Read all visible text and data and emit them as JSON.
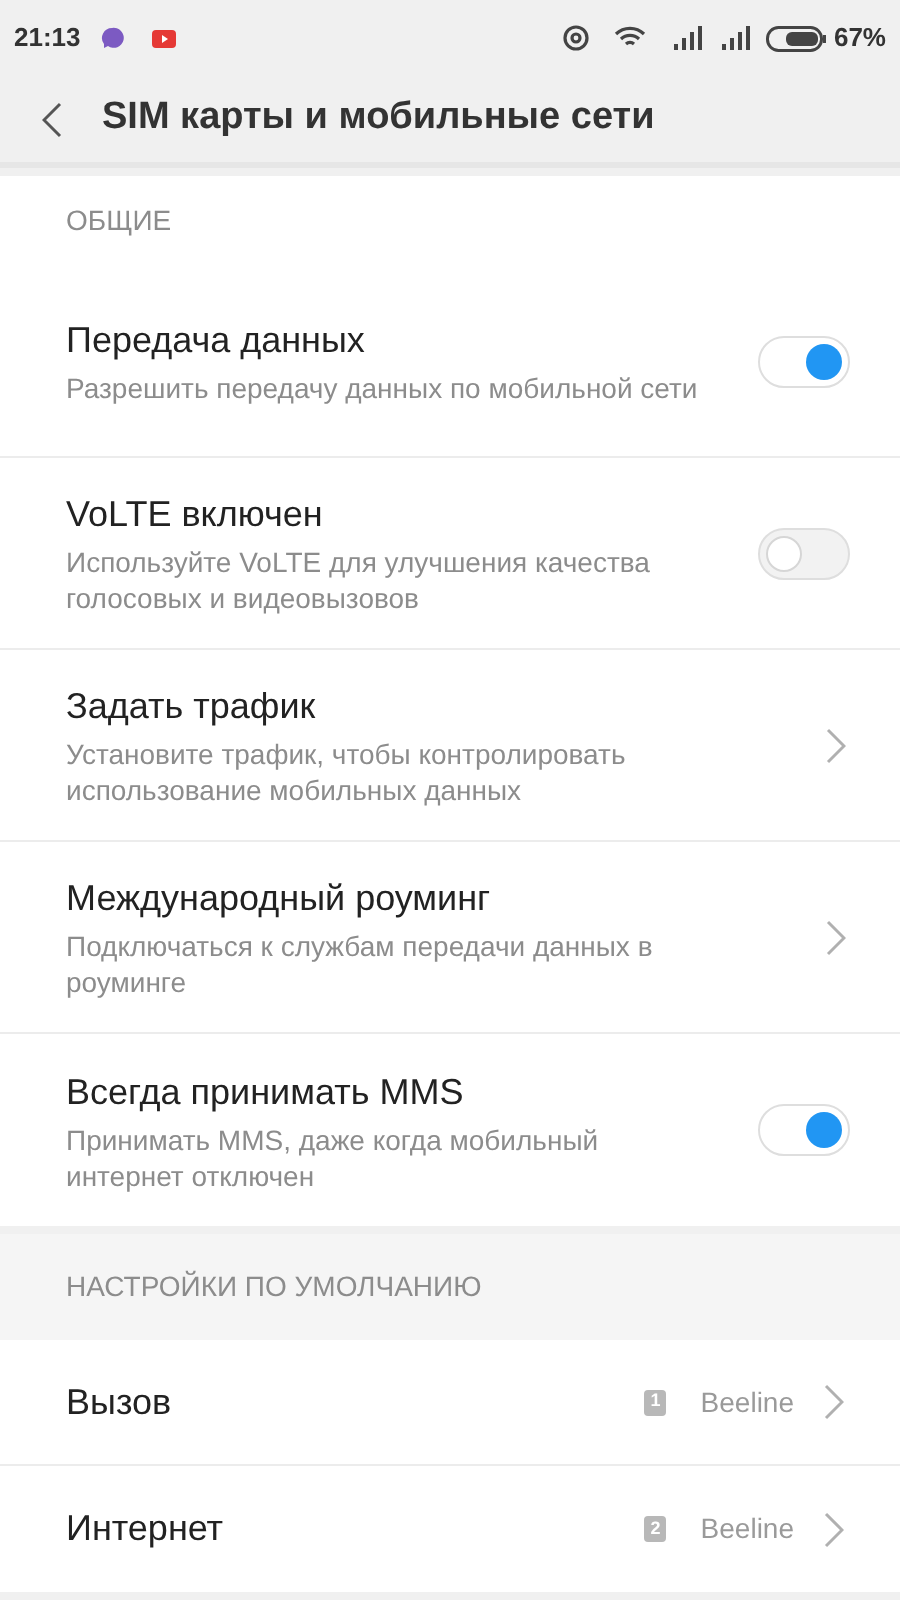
{
  "status_bar": {
    "time": "21:13",
    "battery": "67%"
  },
  "header": {
    "title": "SIM карты и мобильные сети"
  },
  "sections": [
    {
      "title": "ОБЩИЕ",
      "items": [
        {
          "kind": "toggle",
          "title": "Передача данных",
          "subtitle": "Разрешить передачу данных по мобильной сети",
          "on": true
        },
        {
          "kind": "toggle",
          "title": "VoLTE включен",
          "subtitle": "Используйте VoLTE для улучшения качества голосовых и видеовызовов",
          "on": false
        },
        {
          "kind": "link",
          "title": "Задать трафик",
          "subtitle": "Установите трафик, чтобы контролировать использование мобильных данных"
        },
        {
          "kind": "link",
          "title": "Международный роуминг",
          "subtitle": "Подключаться к службам передачи данных в роуминге"
        },
        {
          "kind": "toggle",
          "title": "Всегда принимать MMS",
          "subtitle": "Принимать MMS, даже когда мобильный интернет отключен",
          "on": true
        }
      ]
    },
    {
      "title": "НАСТРОЙКИ ПО УМОЛЧАНИЮ",
      "items": [
        {
          "kind": "sim",
          "title": "Вызов",
          "sim": "1",
          "value": "Beeline"
        },
        {
          "kind": "sim",
          "title": "Интернет",
          "sim": "2",
          "value": "Beeline"
        }
      ]
    }
  ]
}
